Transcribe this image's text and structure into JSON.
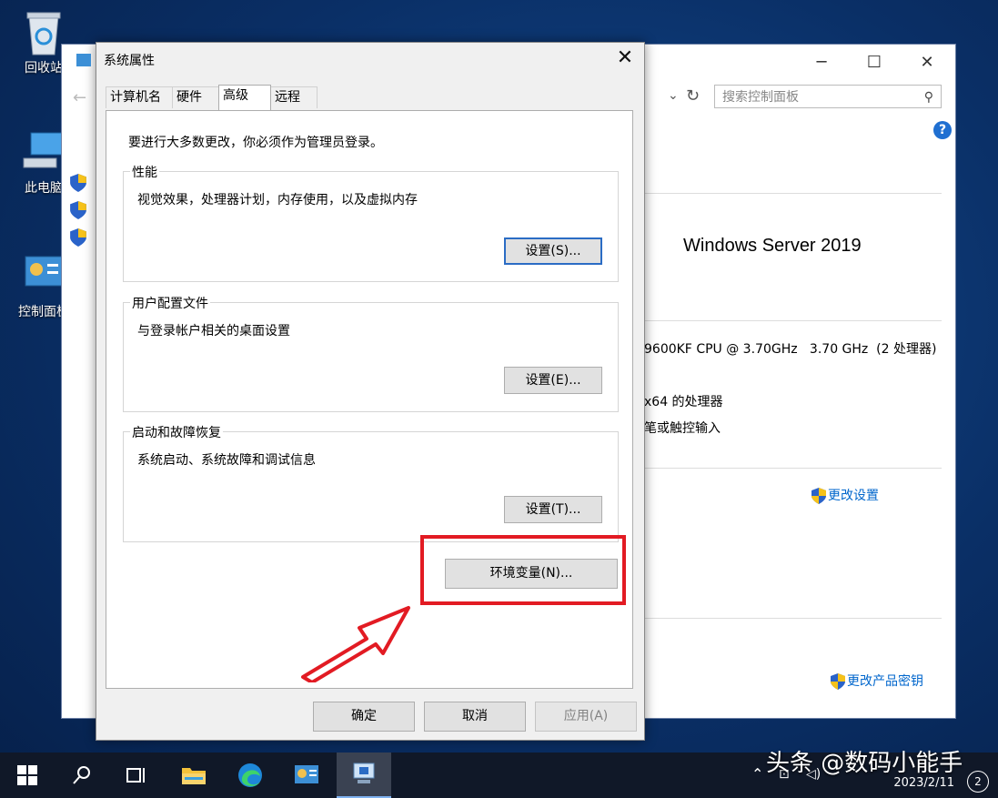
{
  "desktop": {
    "icons": [
      {
        "label": "回收站"
      },
      {
        "label": "此电脑"
      },
      {
        "label": "控制面板"
      }
    ]
  },
  "control_panel": {
    "search_placeholder": "搜索控制面板",
    "os_name": "Windows Server 2019",
    "cpu": "9600KF CPU @ 3.70GHz   3.70 GHz  (2 处理器)",
    "system_type": "x64 的处理器",
    "pen": "笔或触控输入",
    "change_settings": "更改设置",
    "change_product_key": "更改产品密钥"
  },
  "dialog": {
    "title": "系统属性",
    "tabs": [
      {
        "label": "计算机名"
      },
      {
        "label": "硬件"
      },
      {
        "label": "高级"
      },
      {
        "label": "远程"
      }
    ],
    "active_tab": "高级",
    "notice": "要进行大多数更改，你必须作为管理员登录。",
    "groups": [
      {
        "title": "性能",
        "desc": "视觉效果，处理器计划，内存使用，以及虚拟内存",
        "button": "设置(S)..."
      },
      {
        "title": "用户配置文件",
        "desc": "与登录帐户相关的桌面设置",
        "button": "设置(E)..."
      },
      {
        "title": "启动和故障恢复",
        "desc": "系统启动、系统故障和调试信息",
        "button": "设置(T)..."
      }
    ],
    "env_button": "环境变量(N)...",
    "ok": "确定",
    "cancel": "取消",
    "apply": "应用(A)"
  },
  "taskbar": {
    "date": "2023/2/11",
    "notifications": "2"
  },
  "watermark": "头条 @数码小能手",
  "colors": {
    "annotation": "#e21b23",
    "accent": "#2b6cc4"
  }
}
